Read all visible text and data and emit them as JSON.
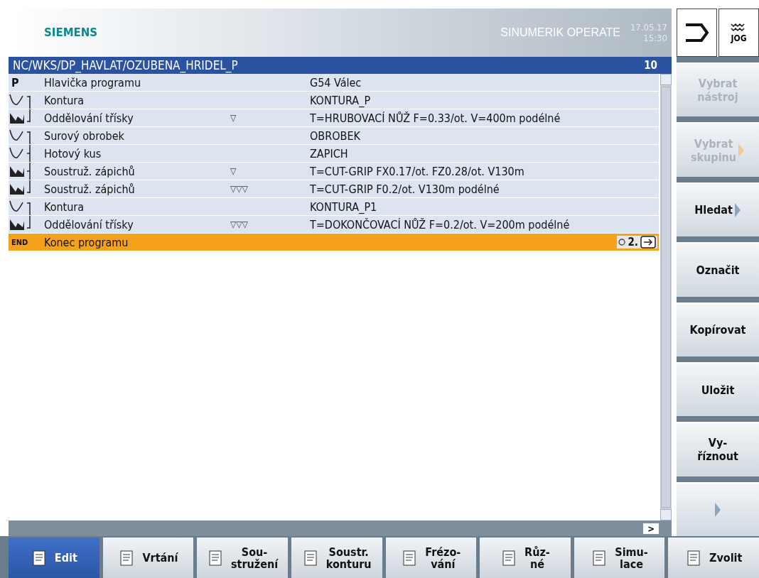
{
  "header": {
    "brand": "SIEMENS",
    "product": "SINUMERIK OPERATE",
    "date": "17.05.17",
    "time": "15:30",
    "mode": "JOG"
  },
  "path_bar": {
    "path": "NC/WKS/DP_HAVLAT/OZUBENA_HRIDEL_P",
    "line": "10"
  },
  "rows": [
    {
      "kind": "header",
      "marker": "P",
      "name": "Hlavička programu",
      "params": "G54 Válec",
      "grouped": false,
      "group_start": false,
      "group_end": false,
      "selected": false
    },
    {
      "kind": "contour",
      "name": "Kontura",
      "params": "KONTURA_P",
      "grouped": true,
      "group_start": true,
      "group_end": false,
      "selected": false
    },
    {
      "kind": "cycle",
      "name": "Oddělování třísky",
      "quality": "▽",
      "params": "T=HRUBOVACÍ NŮŽ F=0.33/ot. V=400m podélné",
      "grouped": true,
      "group_start": false,
      "group_end": true,
      "selected": false
    },
    {
      "kind": "contour",
      "name": "Surový obrobek",
      "params": "OBROBEK",
      "grouped": true,
      "group_start": true,
      "group_end": false,
      "selected": false
    },
    {
      "kind": "contour",
      "name": "Hotový kus",
      "params": "ZAPICH",
      "grouped": true,
      "group_start": false,
      "group_end": false,
      "selected": false
    },
    {
      "kind": "cycle",
      "name": "Soustruž. zápichů",
      "quality": "▽",
      "params": "T=CUT-GRIP FX0.17/ot. FZ0.28/ot. V130m",
      "grouped": true,
      "group_start": false,
      "group_end": false,
      "selected": false
    },
    {
      "kind": "cycle",
      "name": "Soustruž. zápichů",
      "quality": "▽▽▽",
      "params": "T=CUT-GRIP F0.2/ot. V130m podélné",
      "grouped": true,
      "group_start": false,
      "group_end": true,
      "selected": false
    },
    {
      "kind": "contour",
      "name": "Kontura",
      "params": "KONTURA_P1",
      "grouped": true,
      "group_start": true,
      "group_end": false,
      "selected": false
    },
    {
      "kind": "cycle",
      "name": "Oddělování třísky",
      "quality": "▽▽▽",
      "params": "T=DOKONČOVACÍ NŮŽ F=0.2/ot. V=200m podélné",
      "grouped": true,
      "group_start": false,
      "group_end": true,
      "selected": false
    },
    {
      "kind": "end",
      "marker": "END",
      "name": "Konec programu",
      "extra": "2.",
      "grouped": false,
      "group_start": false,
      "group_end": false,
      "selected": true
    }
  ],
  "horizontal_scroll": {
    "arrow": ">"
  },
  "vertical_softkeys": [
    {
      "label": "Vybrat\nnástroj",
      "disabled": true,
      "arrow": false
    },
    {
      "label": "Vybrat\nskupinu",
      "disabled": true,
      "arrow": true
    },
    {
      "label": "Hledat",
      "disabled": false,
      "arrow": true
    },
    {
      "label": "Označit",
      "disabled": false,
      "arrow": false
    },
    {
      "label": "Kopírovat",
      "disabled": false,
      "arrow": false
    },
    {
      "label": "Uložit",
      "disabled": false,
      "arrow": false
    },
    {
      "label": "Vy-\nříznout",
      "disabled": false,
      "arrow": false
    },
    {
      "disabled": false,
      "arrow": true
    }
  ],
  "horizontal_softkeys": [
    {
      "label": "Edit",
      "selected": true
    },
    {
      "label": "Vrtání",
      "selected": false
    },
    {
      "label": "Sou-\nstružení",
      "selected": false
    },
    {
      "label": "Soustr.\nkonturu",
      "selected": false
    },
    {
      "label": "Frézo-\nvání",
      "selected": false
    },
    {
      "label": "Růz-\nné",
      "selected": false
    },
    {
      "label": "Simu-\nlace",
      "selected": false
    },
    {
      "label": "Zvolit",
      "selected": false
    }
  ]
}
